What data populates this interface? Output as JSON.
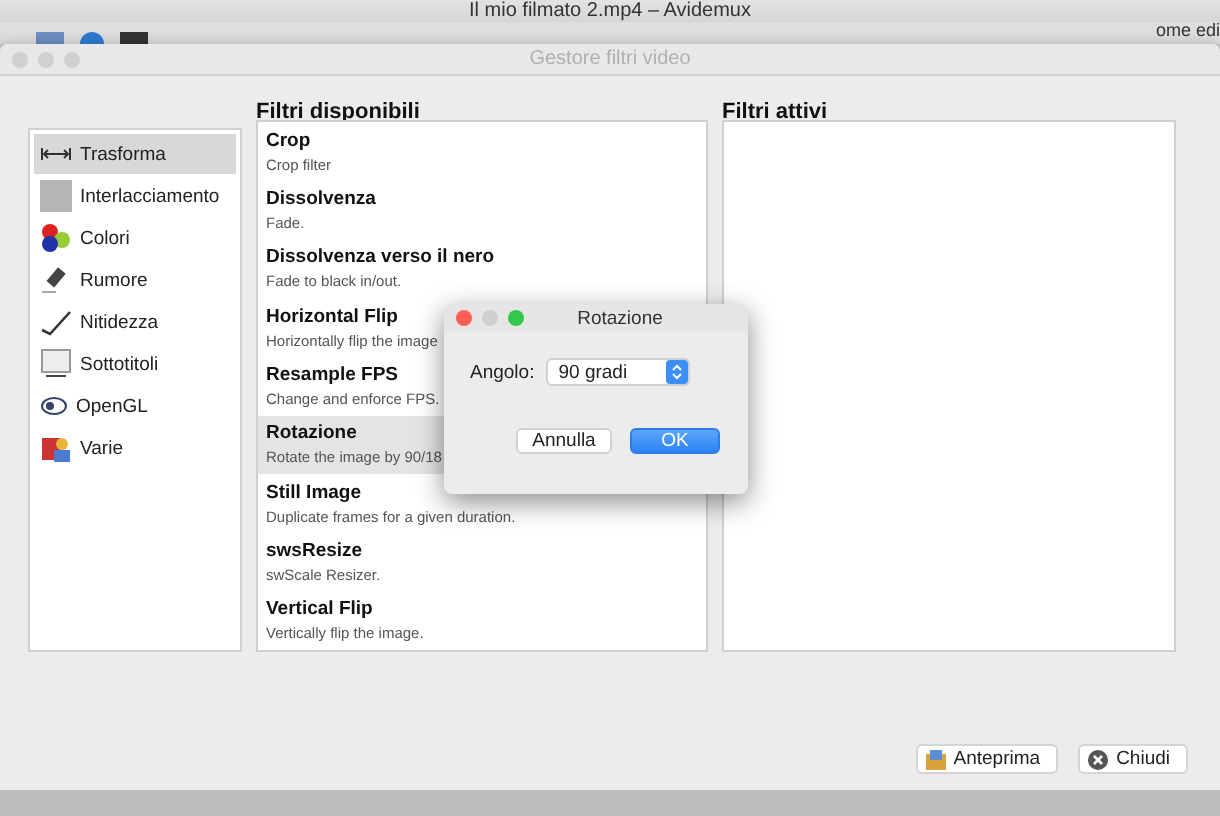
{
  "main_window": {
    "title": "Il mio filmato 2.mp4 – Avidemux",
    "side_text": "ome edi"
  },
  "filter_manager": {
    "title": "Gestore filtri video",
    "available_heading": "Filtri disponibili",
    "active_heading": "Filtri attivi",
    "categories": [
      {
        "label": "Trasforma",
        "selected": true
      },
      {
        "label": "Interlacciamento",
        "selected": false
      },
      {
        "label": "Colori",
        "selected": false
      },
      {
        "label": "Rumore",
        "selected": false
      },
      {
        "label": "Nitidezza",
        "selected": false
      },
      {
        "label": "Sottotitoli",
        "selected": false
      },
      {
        "label": "OpenGL",
        "selected": false
      },
      {
        "label": "Varie",
        "selected": false
      }
    ],
    "filters": [
      {
        "name": "Crop",
        "description": "Crop filter",
        "selected": false
      },
      {
        "name": "Dissolvenza",
        "description": "Fade.",
        "selected": false
      },
      {
        "name": "Dissolvenza verso il nero",
        "description": "Fade to black in/out.",
        "selected": false
      },
      {
        "name": "Horizontal Flip",
        "description": "Horizontally flip the image",
        "selected": false
      },
      {
        "name": "Resample FPS",
        "description": "Change and enforce FPS.",
        "selected": false
      },
      {
        "name": "Rotazione",
        "description": "Rotate the image by 90/18",
        "selected": true
      },
      {
        "name": "Still Image",
        "description": "Duplicate frames for a given duration.",
        "selected": false
      },
      {
        "name": "swsResize",
        "description": "swScale Resizer.",
        "selected": false
      },
      {
        "name": "Vertical Flip",
        "description": "Vertically flip the image.",
        "selected": false
      }
    ],
    "buttons": [
      "Anteprima",
      "Chiudi"
    ]
  },
  "rotation_dialog": {
    "title": "Rotazione",
    "angle_label": "Angolo:",
    "angle_value": "90 gradi",
    "buttons": [
      {
        "label": "Annulla",
        "default": false
      },
      {
        "label": "OK",
        "default": true
      }
    ]
  }
}
